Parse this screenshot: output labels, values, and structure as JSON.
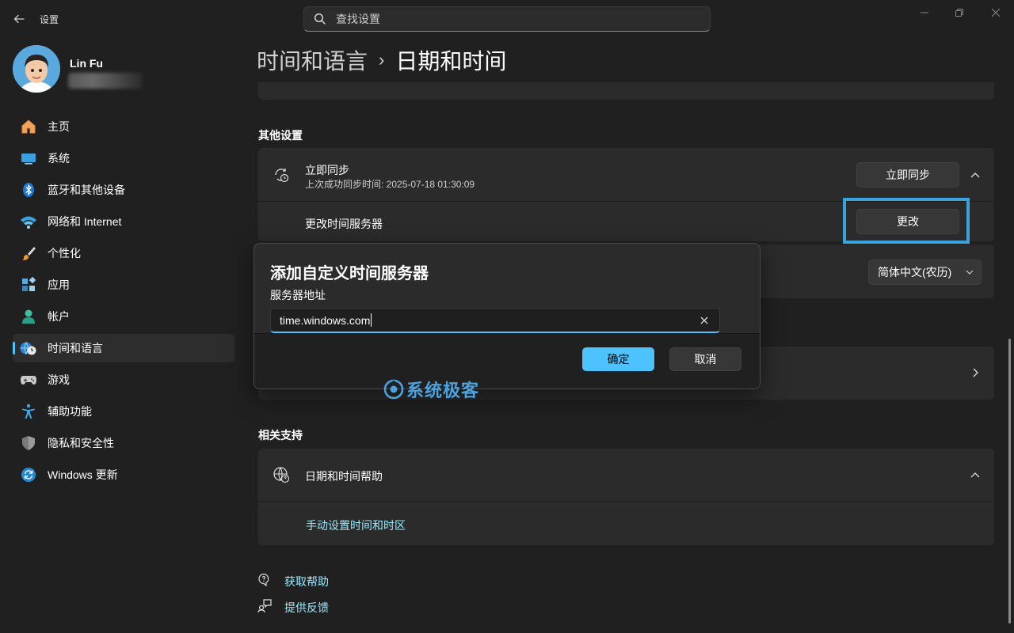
{
  "window": {
    "title": "设置",
    "search_placeholder": "查找设置"
  },
  "profile": {
    "name": "Lin Fu"
  },
  "nav": {
    "items": [
      {
        "label": "主页",
        "icon": "home-icon"
      },
      {
        "label": "系统",
        "icon": "monitor-icon"
      },
      {
        "label": "蓝牙和其他设备",
        "icon": "bluetooth-icon"
      },
      {
        "label": "网络和 Internet",
        "icon": "wifi-icon"
      },
      {
        "label": "个性化",
        "icon": "brush-icon"
      },
      {
        "label": "应用",
        "icon": "apps-icon"
      },
      {
        "label": "帐户",
        "icon": "account-icon"
      },
      {
        "label": "时间和语言",
        "icon": "globe-clock-icon"
      },
      {
        "label": "游戏",
        "icon": "gamepad-icon"
      },
      {
        "label": "辅助功能",
        "icon": "accessibility-icon"
      },
      {
        "label": "隐私和安全性",
        "icon": "shield-icon"
      },
      {
        "label": "Windows 更新",
        "icon": "update-icon"
      }
    ],
    "active_index": 7
  },
  "breadcrumb": {
    "parent": "时间和语言",
    "separator": "›",
    "current": "日期和时间"
  },
  "other_settings": {
    "title": "其他设置",
    "sync": {
      "title": "立即同步",
      "subtitle": "上次成功同步时间: 2025-07-18 01:30:09",
      "button": "立即同步"
    },
    "change_server": {
      "title": "更改时间服务器",
      "button": "更改"
    },
    "calendar": {
      "selected": "简体中文(农历)"
    }
  },
  "related": {
    "title": "相关支持",
    "help": {
      "title": "日期和时间帮助",
      "link": "手动设置时间和时区"
    }
  },
  "footer_links": {
    "get_help": "获取帮助",
    "feedback": "提供反馈"
  },
  "dialog": {
    "title": "添加自定义时间服务器",
    "label": "服务器地址",
    "value": "time.windows.com",
    "ok": "确定",
    "cancel": "取消"
  },
  "watermark": {
    "text": "系统极客"
  },
  "colors": {
    "accent": "#4cc2ff",
    "background": "#202020",
    "card": "#2b2b2b",
    "highlight": "#3aa3dc"
  }
}
